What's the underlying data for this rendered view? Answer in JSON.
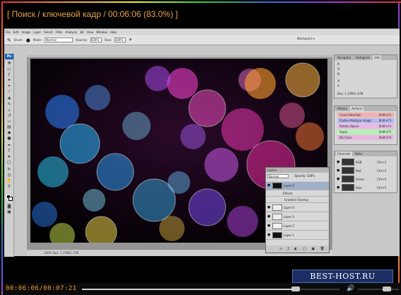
{
  "player": {
    "title": "[ Поиск / ключевой кадр / 00:06:06 (83.0%) ]",
    "timecode": "00:06:06/00:07:21",
    "progress": 0.83,
    "volume": 0.7,
    "watermark": "BEST-HOST.RU"
  },
  "photoshop": {
    "menu": [
      "File",
      "Edit",
      "Image",
      "Layer",
      "Select",
      "Filter",
      "Analysis",
      "3D",
      "View",
      "Window",
      "Help"
    ],
    "options": {
      "brush_label": "Brush:",
      "mode_label": "Mode:",
      "mode_value": "Normal",
      "opacity_label": "Opacity:",
      "opacity_value": "100%",
      "flow_label": "Flow:",
      "flow_value": "100%",
      "workspace": "Workspace ▾"
    },
    "status_text": "100% Doc: 1.37M/1.37M",
    "panels": {
      "info_tabs": [
        "Navigator",
        "Histogram",
        "Info"
      ],
      "info_rows": [
        "R:",
        "G:",
        "B:",
        "X:",
        "Y:"
      ],
      "info_footer": "Doc: 1.37M/1.37M",
      "actions_tabs": [
        "History",
        "Actions"
      ],
      "actions": [
        {
          "label": "Cross Selection",
          "key": "Shift+F2",
          "color": "#f0b2b2"
        },
        {
          "label": "Flatten Multiple Image",
          "key": "Shift+F3",
          "color": "#b8b8f0"
        },
        {
          "label": "Rotate Object",
          "key": "Shift+F4",
          "color": "#e8b8e8"
        },
        {
          "label": "Sepia",
          "key": "Shift+F5",
          "color": "#b8f0b8"
        },
        {
          "label": "BG Color",
          "key": "Shift+F6",
          "color": "#e6b8e0"
        }
      ],
      "channels_tabs": [
        "Channels",
        "Paths"
      ],
      "channels": [
        {
          "name": "RGB",
          "key": "Ctrl+2"
        },
        {
          "name": "Red",
          "key": "Ctrl+3"
        },
        {
          "name": "Green",
          "key": "Ctrl+4"
        },
        {
          "name": "Blue",
          "key": "Ctrl+5"
        }
      ],
      "layers_tabs": [
        "Layers"
      ],
      "blend_mode": "Normal",
      "opacity": "Opacity: 100%",
      "layers": [
        {
          "name": "Layer 5",
          "selected": true,
          "dark": true
        },
        {
          "name": "Effects",
          "selected": false,
          "dark": false
        },
        {
          "name": "Gradient Overlay",
          "selected": false,
          "dark": false
        },
        {
          "name": "Layer 4",
          "selected": false,
          "dark": false
        },
        {
          "name": "Layer 3",
          "selected": false,
          "dark": false
        },
        {
          "name": "Layer 2",
          "selected": false,
          "dark": false
        },
        {
          "name": "Layer 1",
          "selected": false,
          "dark": true
        }
      ]
    }
  }
}
